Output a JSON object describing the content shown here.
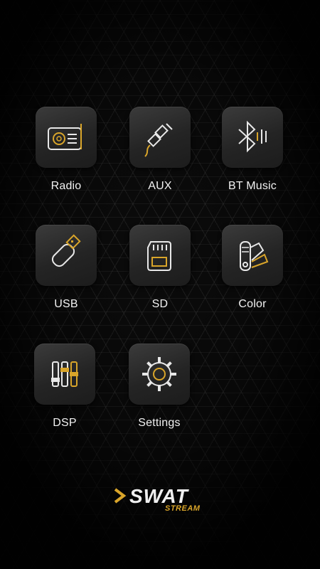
{
  "apps": [
    {
      "label": "Radio",
      "icon": "radio-icon"
    },
    {
      "label": "AUX",
      "icon": "aux-cable-icon"
    },
    {
      "label": "BT Music",
      "icon": "bluetooth-icon"
    },
    {
      "label": "USB",
      "icon": "usb-drive-icon"
    },
    {
      "label": "SD",
      "icon": "sd-card-icon"
    },
    {
      "label": "Color",
      "icon": "color-palette-icon"
    },
    {
      "label": "DSP",
      "icon": "equalizer-icon"
    },
    {
      "label": "Settings",
      "icon": "gear-icon"
    }
  ],
  "logo": {
    "main": "SWAT",
    "sub": "STREAM"
  },
  "colors": {
    "accent": "#d9a52a",
    "line": "#e8e8e8"
  }
}
